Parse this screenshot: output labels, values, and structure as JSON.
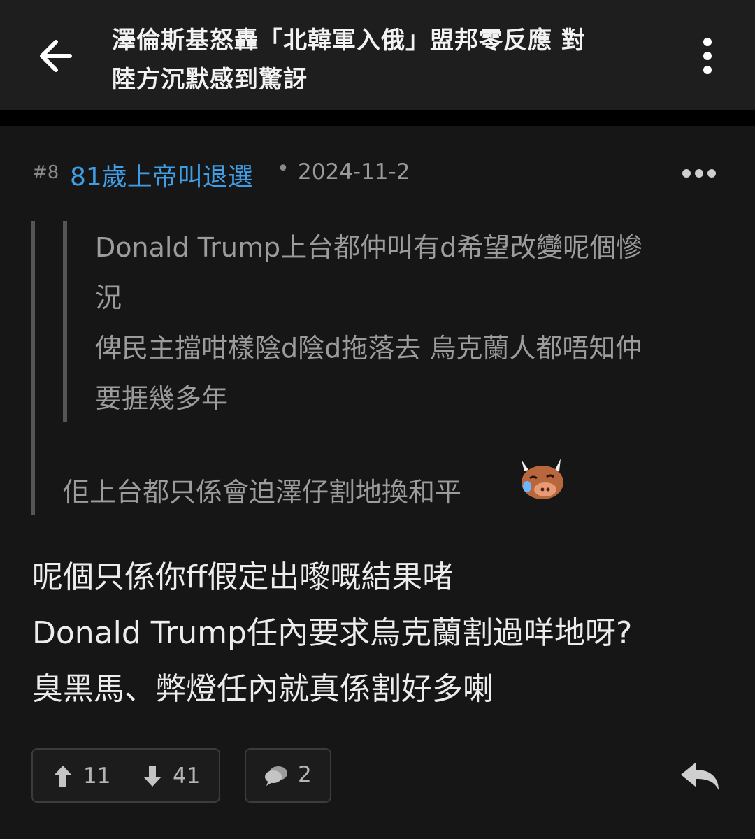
{
  "header": {
    "title_lines": [
      "澤倫斯基怒轟「北韓軍入俄」盟邦零反應 對",
      "陸方沉默感到驚訝"
    ],
    "back_icon": "arrow-left-icon",
    "more_icon": "vertical-dots-icon"
  },
  "post": {
    "number": "#8",
    "username": "81歲上帝叫退選",
    "separator": "•",
    "date": "2024-11-2",
    "username_color": "#3f9ee6",
    "quote": {
      "inner_lines": [
        "Donald Trump上台都仲叫有d希望改變呢個慘",
        "況",
        "俾民主擋咁樣陰d陰d拖落去 烏克蘭人都唔知仲",
        "要捱幾多年"
      ],
      "outer_line": "佢上台都只係會迫澤仔割地換和平",
      "emoji": "crying-bull-emoji"
    },
    "body_lines": [
      "呢個只係你ff假定出嚟嘅結果啫",
      "Donald Trump任內要求烏克蘭割過咩地呀?",
      "臭黑馬、弊燈任內就真係割好多喇"
    ],
    "actions": {
      "upvotes": "11",
      "downvotes": "41",
      "comments": "2",
      "reply_icon": "reply-arrow-icon"
    }
  }
}
